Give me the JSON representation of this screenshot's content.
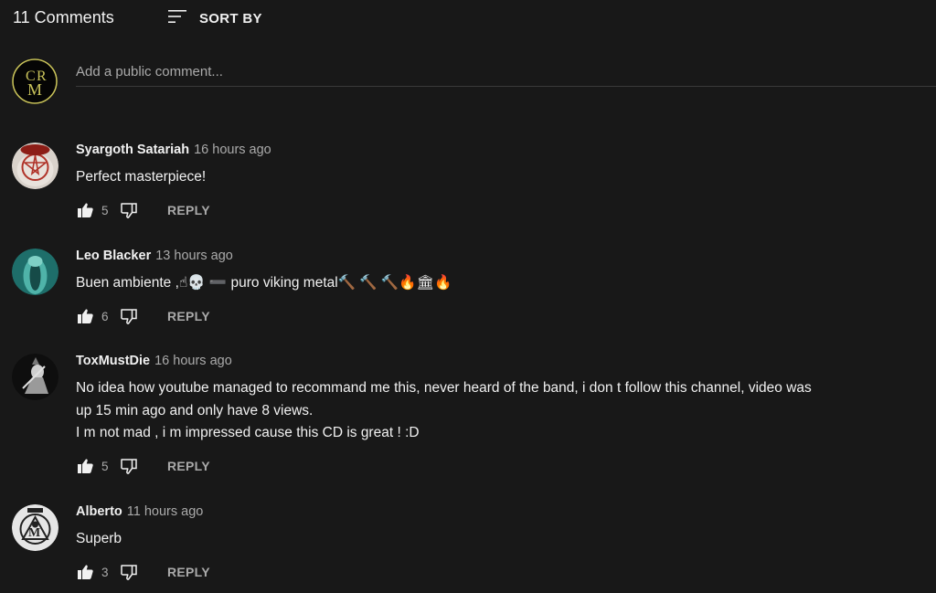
{
  "header": {
    "count": "11 Comments",
    "sort_label": "SORT BY"
  },
  "add_comment": {
    "placeholder": "Add a public comment...",
    "avatar_initials": "CRM"
  },
  "comments": [
    {
      "author": "Syargoth Satariah",
      "time": "16 hours ago",
      "lines": [
        "Perfect masterpiece!"
      ],
      "likes": "5",
      "reply": "REPLY"
    },
    {
      "author": "Leo Blacker",
      "time": "13 hours ago",
      "lines": [
        "Buen ambiente ,☝💀 ➖ puro viking metal🔨 🔨 🔨🔥🏛🔥"
      ],
      "likes": "6",
      "reply": "REPLY"
    },
    {
      "author": "ToxMustDie",
      "time": "16 hours ago",
      "lines": [
        "No idea how youtube managed to recommand me this, never heard of the band, i don t follow this channel, video was",
        "up 15 min ago and  only have 8 views.",
        "I m not mad , i m impressed cause this CD is great ! :D"
      ],
      "likes": "5",
      "reply": "REPLY"
    },
    {
      "author": "Alberto",
      "time": "11 hours ago",
      "lines": [
        "Superb"
      ],
      "likes": "3",
      "reply": "REPLY"
    }
  ],
  "colors": {
    "background": "#181818",
    "text": "#f1f1f1",
    "secondary": "#aaaaaa",
    "divider": "#3a3a3a",
    "crm_gold": "#c8c25a"
  }
}
